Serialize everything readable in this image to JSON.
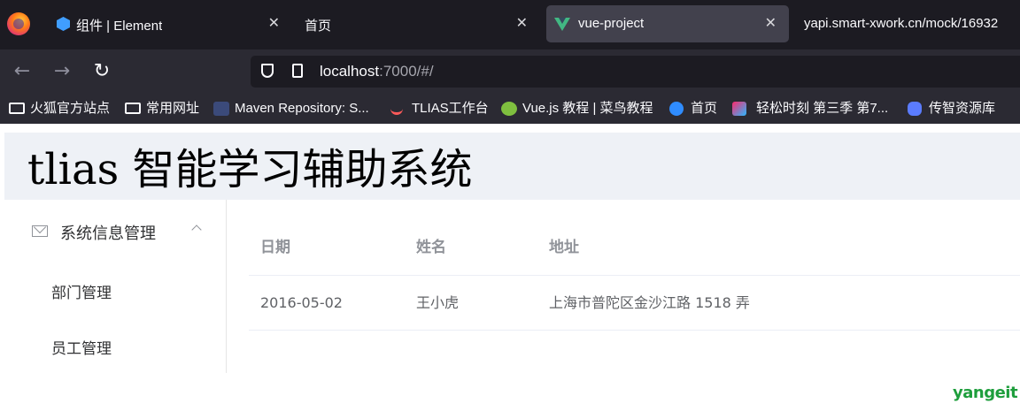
{
  "browser": {
    "tabs": [
      {
        "label": "组件 | Element",
        "icon": "element-icon"
      },
      {
        "label": "首页",
        "icon": ""
      },
      {
        "label": "vue-project",
        "icon": "vue-icon",
        "active": true
      },
      {
        "label": "yapi.smart-xwork.cn/mock/16932"
      }
    ],
    "url_host": "localhost",
    "url_rest": ":7000/#/",
    "bookmarks": [
      {
        "label": "火狐官方站点",
        "icon": "folder-icon"
      },
      {
        "label": "常用网址",
        "icon": "folder-icon"
      },
      {
        "label": "Maven Repository: S...",
        "icon": "maven-icon"
      },
      {
        "label": "TLIAS工作台",
        "icon": "tlias-icon"
      },
      {
        "label": "Vue.js 教程 | 菜鸟教程",
        "icon": "runoob-icon"
      },
      {
        "label": "首页",
        "icon": "bilibili-icon"
      },
      {
        "label": "轻松时刻 第三季 第7...",
        "icon": "youku-icon"
      },
      {
        "label": "传智资源库",
        "icon": "database-icon"
      }
    ]
  },
  "app": {
    "title": "tlias 智能学习辅助系统",
    "menu": {
      "group_label": "系统信息管理",
      "items": [
        "部门管理",
        "员工管理"
      ]
    },
    "table": {
      "headers": [
        "日期",
        "姓名",
        "地址"
      ],
      "rows": [
        [
          "2016-05-02",
          "王小虎",
          "上海市普陀区金沙江路 1518 弄"
        ]
      ]
    }
  },
  "watermark": "yangeit",
  "colors": {
    "tabbar": "#1c1b22",
    "header_bg": "#eef1f6",
    "accent": "#409eff",
    "watermark": "#1e9e3c"
  }
}
